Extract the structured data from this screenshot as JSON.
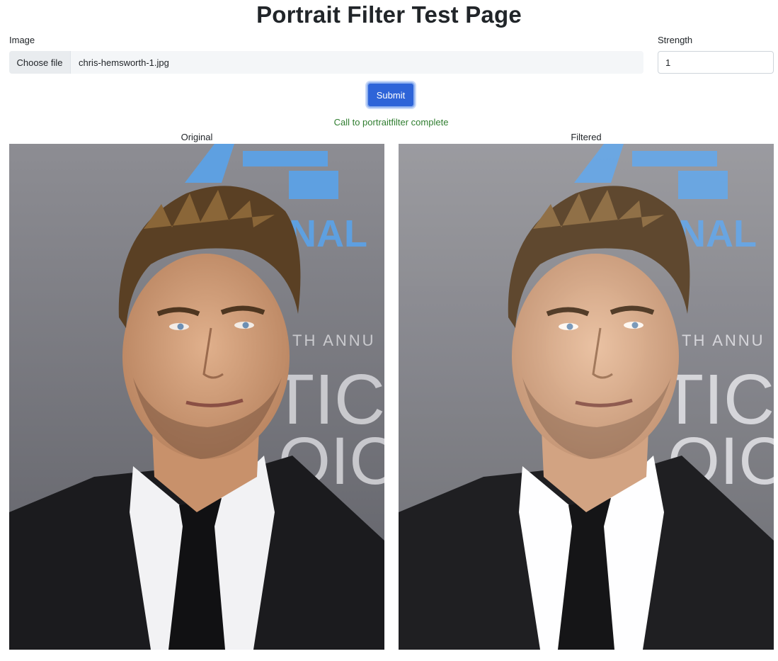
{
  "page": {
    "title": "Portrait Filter Test Page"
  },
  "form": {
    "image_label": "Image",
    "file_button_label": "Choose file",
    "file_name": "chris-hemsworth-1.jpg",
    "strength_label": "Strength",
    "strength_value": "1",
    "submit_label": "Submit"
  },
  "status": {
    "message": "Call to portraitfilter complete",
    "color": "#2f7d2f"
  },
  "results": {
    "original_caption": "Original",
    "filtered_caption": "Filtered"
  },
  "colors": {
    "accent": "#2e64d8"
  }
}
